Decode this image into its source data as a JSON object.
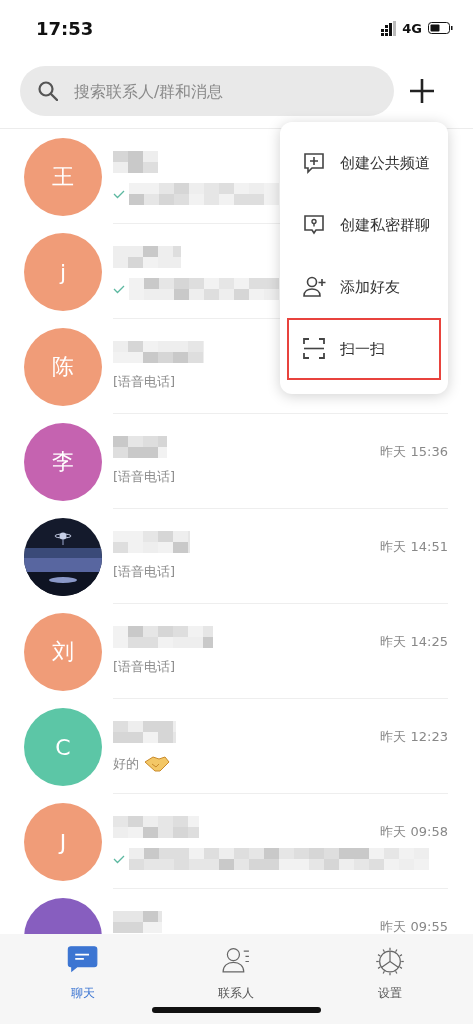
{
  "status_bar": {
    "time": "17:53",
    "network": "4G"
  },
  "search": {
    "placeholder": "搜索联系人/群和消息"
  },
  "chats": [
    {
      "avatar": {
        "kind": "letter",
        "text": "王",
        "color": "#f09c78"
      },
      "preview": {
        "kind": "blurred",
        "sent": true
      }
    },
    {
      "avatar": {
        "kind": "letter",
        "text": "j",
        "color": "#f09c78"
      },
      "preview": {
        "kind": "blurred",
        "sent": true
      }
    },
    {
      "avatar": {
        "kind": "letter",
        "text": "陈",
        "color": "#f09c78"
      },
      "preview": {
        "kind": "text",
        "text": "[语音电话]"
      }
    },
    {
      "avatar": {
        "kind": "letter",
        "text": "李",
        "color": "#c563b0"
      },
      "time": "昨天 15:36",
      "preview": {
        "kind": "text",
        "text": "[语音电话]"
      }
    },
    {
      "time": "昨天 14:51",
      "preview": {
        "kind": "text",
        "text": "[语音电话]"
      }
    },
    {
      "avatar": {
        "kind": "letter",
        "text": "刘",
        "color": "#f09c78"
      },
      "time": "昨天 14:25",
      "preview": {
        "kind": "text",
        "text": "[语音电话]"
      }
    },
    {
      "avatar": {
        "kind": "letter",
        "text": "C",
        "color": "#5cc6a6"
      },
      "time": "昨天 12:23",
      "preview": {
        "kind": "text",
        "text": "好的",
        "emoji": true
      }
    },
    {
      "avatar": {
        "kind": "letter",
        "text": "J",
        "color": "#f09c78"
      },
      "time": "昨天 09:58",
      "preview": {
        "kind": "blurred",
        "sent": true
      }
    },
    {
      "avatar": {
        "kind": "hidden",
        "color": "#875ebf"
      },
      "time": "昨天 09:55"
    }
  ],
  "menu": [
    {
      "label": "创建公共频道",
      "selected": false
    },
    {
      "label": "创建私密群聊",
      "selected": false
    },
    {
      "label": "添加好友",
      "selected": false
    },
    {
      "label": "扫一扫",
      "selected": true
    }
  ],
  "tabs": [
    {
      "label": "聊天",
      "selected": true
    },
    {
      "label": "联系人",
      "selected": false
    },
    {
      "label": "设置",
      "selected": false
    }
  ]
}
